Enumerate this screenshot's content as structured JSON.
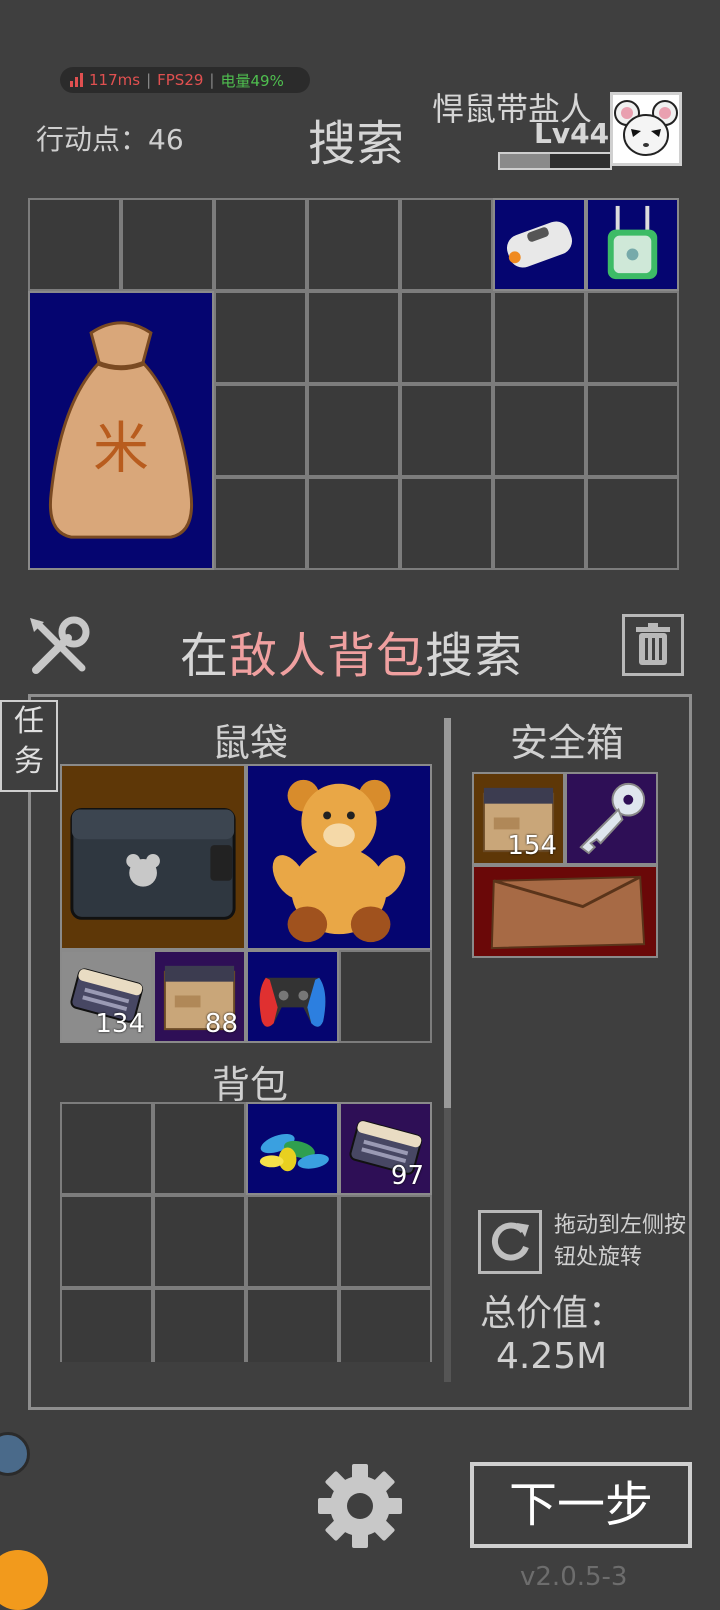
{
  "status": {
    "ping": "117ms",
    "fps": "FPS29",
    "battery": "电量49%",
    "colors": {
      "ping": "#e05050",
      "battery": "#4fbf4f"
    }
  },
  "header": {
    "action_points": "行动点：46",
    "title": "搜索",
    "player_name": "悍鼠带盐人",
    "player_level": "Lv44",
    "xp_progress": 0.45
  },
  "loot": {
    "title_prefix": "在",
    "title_highlight": "敌人背包",
    "title_suffix": "搜索",
    "items": [
      {
        "name": "power-bank",
        "color": "navy"
      },
      {
        "name": "wifi-router",
        "color": "navy"
      },
      {
        "name": "rice-sack",
        "color": "navy"
      }
    ]
  },
  "inventory": {
    "task_tab": "任务",
    "pouch_label": "鼠袋",
    "backpack_label": "背包",
    "safe_label": "安全箱",
    "pouch_items": [
      {
        "name": "weapon-case",
        "qty": ""
      },
      {
        "name": "teddy-bear",
        "qty": ""
      },
      {
        "name": "ammo-box-gray",
        "qty": "134"
      },
      {
        "name": "supply-crate",
        "qty": "88"
      },
      {
        "name": "game-controller",
        "qty": ""
      }
    ],
    "backpack_items": [
      {
        "name": "candies",
        "qty": ""
      },
      {
        "name": "ammo-box-purple",
        "qty": "97"
      }
    ],
    "safe_items": [
      {
        "name": "supply-crate",
        "qty": "154"
      },
      {
        "name": "key",
        "qty": ""
      },
      {
        "name": "leather-folder",
        "qty": ""
      }
    ]
  },
  "footer": {
    "rotate_hint": "拖动到左侧按钮处旋转",
    "total_label": "总价值：",
    "total_value": "4.25M",
    "next_button": "下一步",
    "version": "v2.0.5-3"
  }
}
